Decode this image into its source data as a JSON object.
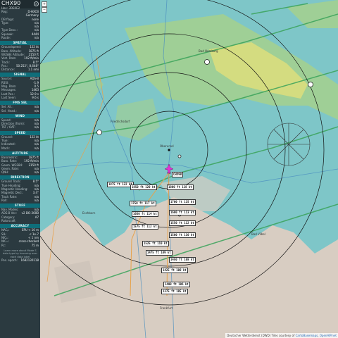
{
  "panel": {
    "callsign": "CHX90",
    "hex_label": "Hex: 3DE0E2",
    "close_glyph": "×",
    "sections": [
      {
        "id": "top",
        "title": "",
        "rows": [
          {
            "k": "Reg:",
            "v": "D-HXCB"
          },
          {
            "k": "",
            "v": "Germany"
          },
          {
            "k": "DB flags:",
            "v": "none"
          },
          {
            "k": "Type:",
            "v": "n/a"
          },
          {
            "k": "",
            "v": "n/a"
          },
          {
            "k": "Type Desc.:",
            "v": "n/a"
          },
          {
            "k": "Squawk:",
            "v": "4444"
          },
          {
            "k": "Route:",
            "v": "n/a"
          }
        ]
      },
      {
        "id": "spatial",
        "title": "SPATIAL",
        "rows": [
          {
            "k": "Groundspeed:",
            "v": "122 kt"
          },
          {
            "k": "Baro. Altitude:",
            "v": "1875 ft"
          },
          {
            "k": "WGS84 Altitude:",
            "v": "2150 ft"
          },
          {
            "k": "Vert. Rate:",
            "v": "192 ft/min"
          },
          {
            "k": "Track:",
            "v": "8.5°"
          },
          {
            "k": "Pos.:",
            "v": "50.252°, 8.648°"
          },
          {
            "k": "Distance:",
            "v": "1.1 nmi"
          }
        ]
      },
      {
        "id": "signal",
        "title": "SIGNAL",
        "rows": [
          {
            "k": "Source:",
            "v": "ADS-B"
          },
          {
            "k": "RSSI:",
            "v": "-1.9"
          },
          {
            "k": "Msg. Rate:",
            "v": "0.5"
          },
          {
            "k": "Messages:",
            "v": "1463"
          },
          {
            "k": "Last Pos.:",
            "v": "12.9 s"
          },
          {
            "k": "Last Seen:",
            "v": "9.6 s"
          }
        ]
      },
      {
        "id": "fmssel",
        "title": "FMS SEL",
        "rows": [
          {
            "k": "Sel. Alt.:",
            "v": "n/a"
          },
          {
            "k": "Sel. Head.:",
            "v": "n/a"
          }
        ]
      },
      {
        "id": "wind",
        "title": "WIND",
        "rows": [
          {
            "k": "Speed:",
            "v": "n/a"
          },
          {
            "k": "Direction (from):",
            "v": "n/a"
          },
          {
            "k": "TAT / OAT:",
            "v": "n/a"
          }
        ]
      },
      {
        "id": "speed",
        "title": "SPEED",
        "rows": [
          {
            "k": "Ground:",
            "v": "122 kt"
          },
          {
            "k": "True:",
            "v": "n/a"
          },
          {
            "k": "Indicated:",
            "v": "n/a"
          },
          {
            "k": "Mach:",
            "v": "n/a"
          }
        ]
      },
      {
        "id": "altitude",
        "title": "ALTITUDE",
        "rows": [
          {
            "k": "Barometric:",
            "v": "1875 ft"
          },
          {
            "k": "Baro. Rate:",
            "v": "192 ft/min"
          },
          {
            "k": "Geom. WGS84:",
            "v": "2150 ft"
          },
          {
            "k": "Geom. Rate:",
            "v": "n/a"
          },
          {
            "k": "QNH:",
            "v": "n/a"
          }
        ]
      },
      {
        "id": "direction",
        "title": "DIRECTION",
        "rows": [
          {
            "k": "Ground Track:",
            "v": "8.5°"
          },
          {
            "k": "True Heading:",
            "v": "n/a"
          },
          {
            "k": "Magnetic Heading:",
            "v": "n/a"
          },
          {
            "k": "Magnetic Decl.:",
            "v": "3.4°"
          },
          {
            "k": "Track Rate:",
            "v": "n/a"
          },
          {
            "k": "Roll:",
            "v": "n/a"
          }
        ]
      },
      {
        "id": "stuff",
        "title": "STUFF",
        "rows": [
          {
            "k": "Nav. Modes:",
            "v": "n/a"
          },
          {
            "k": "ADS-B Ver.:",
            "v": "v2 DO-260B"
          },
          {
            "k": "Category:",
            "v": "A7"
          },
          {
            "k": "Rotorcraft",
            "v": ""
          }
        ]
      },
      {
        "id": "accuracy",
        "title": "ACCURACY",
        "rows": [
          {
            "k": "NACₚ:",
            "v": "EPU < 10 m"
          },
          {
            "k": "SIL:",
            "v": "< 1e-7"
          },
          {
            "k": "NICₐ:",
            "v": "< 1 nm"
          },
          {
            "k": "NICₘ:",
            "v": "cross-checked"
          },
          {
            "k": "Rc:",
            "v": "75 m"
          }
        ]
      }
    ],
    "note": "Learn more about Mode S data type by hovering over each data label",
    "footer_row": {
      "k": "Pos. epoch:",
      "v": "1682130118"
    }
  },
  "map": {
    "attribution_text": "Deutscher Wetterdienst (DWD) Tiles courtesy of ",
    "attribution_link1": "CartoBasemaps",
    "attribution_link2": "OpenAIP.net",
    "zoom_in": "+",
    "zoom_out": "−",
    "aircraft_label_main": "CHX90",
    "track_labels": [
      "1875 ft 122 kt",
      "1850 ft 120 kt",
      "1800 ft 118 kt",
      "1750 ft 117 kt",
      "1700 ft 115 kt",
      "1650 ft 114 kt",
      "1600 ft 113 kt",
      "1575 ft 112 kt",
      "1550 ft 112 kt",
      "1525 ft 110 kt",
      "1500 ft 110 kt",
      "1475 ft 109 kt",
      "1450 ft 108 kt",
      "1425 ft 108 kt",
      "1400 ft 106 kt",
      "1375 ft 105 kt"
    ],
    "places": [
      "Bad Homburg",
      "Friedrichsdorf",
      "Oberursel",
      "Bad Vilbel",
      "Eschborn",
      "Frankfurt"
    ],
    "colors": {
      "map_bg": "#7ec6c8",
      "radar_yellow": "#d9dd7d",
      "radar_green": "#9fcf96",
      "land": "#d8cdc2",
      "aircraft": "#e533d4",
      "panel_bg": "#2b3a40",
      "section_bg": "#0f6e7a"
    }
  }
}
